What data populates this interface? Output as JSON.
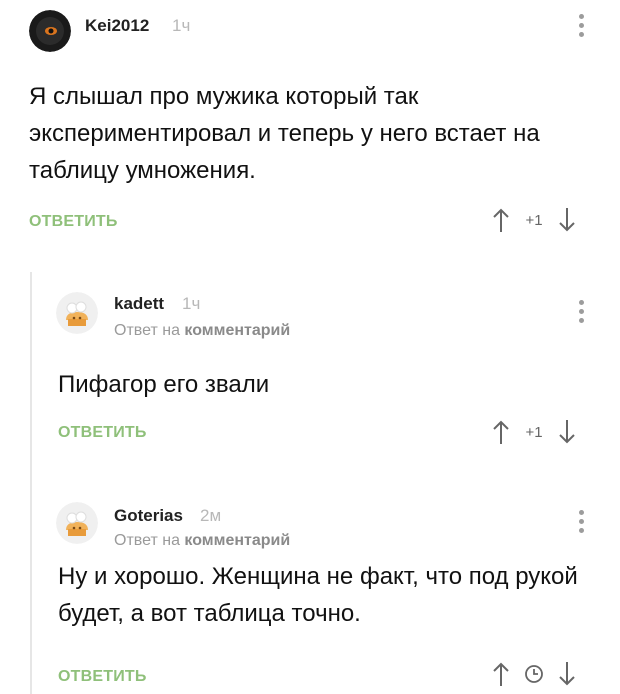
{
  "comments": [
    {
      "author": "Kei2012",
      "time": "1ч",
      "text": "Я слышал про мужика который так экспериментировал и теперь у него встает на таблицу умножения.",
      "reply_label": "ОТВЕТИТЬ",
      "score": "+1"
    },
    {
      "author": "kadett",
      "time": "1ч",
      "reply_prefix": "Ответ на",
      "reply_target": "комментарий",
      "text": "Пифагор его звали",
      "reply_label": "ОТВЕТИТЬ",
      "score": "+1"
    },
    {
      "author": "Goterias",
      "time": "2м",
      "reply_prefix": "Ответ на",
      "reply_target": "комментарий",
      "text": "Ну и хорошо. Женщина не факт, что под рукой будет, а вот таблица точно.",
      "reply_label": "ОТВЕТИТЬ",
      "score_icon": "clock-icon"
    }
  ],
  "icons": {
    "upvote": "arrow-up-icon",
    "downvote": "arrow-down-icon",
    "menu": "more-vertical-icon"
  },
  "colors": {
    "reply_link": "#8fc07a",
    "muted_text": "#9a9a9a"
  }
}
